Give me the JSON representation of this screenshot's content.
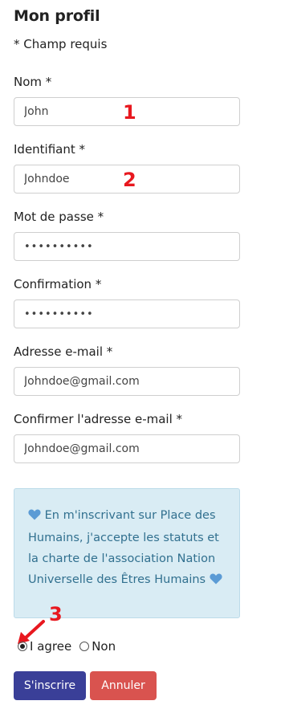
{
  "page": {
    "title": "Mon profil",
    "required_note": "* Champ requis"
  },
  "form": {
    "nom": {
      "label": "Nom *",
      "value": "John"
    },
    "identifiant": {
      "label": "Identifiant *",
      "value": "Johndoe"
    },
    "mot_de_passe": {
      "label": "Mot de passe *",
      "value": "••••••••••"
    },
    "confirmation": {
      "label": "Confirmation *",
      "value": "••••••••••"
    },
    "email": {
      "label": "Adresse e-mail *",
      "value": "Johndoe@gmail.com"
    },
    "email_confirm": {
      "label": "Confirmer l'adresse e-mail *",
      "value": "Johndoe@gmail.com"
    }
  },
  "agreement": {
    "text": "En m'inscrivant sur Place des Humains, j'accepte les statuts et la charte de l'association Nation Universelle des Êtres Humains",
    "icon": "heart-icon",
    "box_color": "#d9ecf4",
    "text_color": "#31708f",
    "heart_color": "#5b9bd5"
  },
  "options": {
    "agree_label": "I agree",
    "agree_selected": true,
    "non_label": "Non",
    "non_selected": false
  },
  "buttons": {
    "submit_label": "S'inscrire",
    "cancel_label": "Annuler",
    "submit_color": "#3a3f98",
    "cancel_color": "#d9534f"
  },
  "annotations": {
    "step1": "1",
    "step2": "2",
    "step3": "3",
    "color": "#e8181f"
  }
}
